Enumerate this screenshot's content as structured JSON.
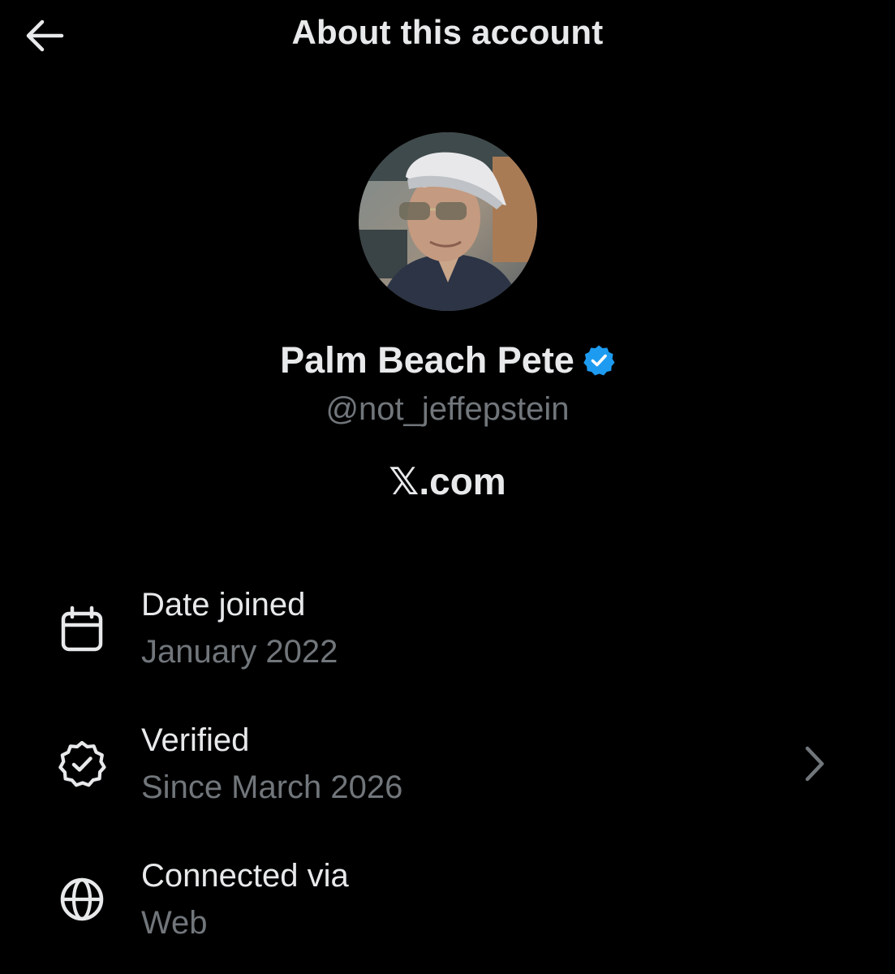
{
  "header": {
    "title": "About this account",
    "back_icon": "arrow-left-icon"
  },
  "profile": {
    "avatar_icon": "profile-photo",
    "display_name": "Palm Beach Pete",
    "verified_badge_icon": "verified-badge-icon",
    "handle": "@not_jeffepstein",
    "site": "𝕏.com"
  },
  "details": [
    {
      "icon": "calendar-icon",
      "label": "Date joined",
      "value": "January 2022"
    },
    {
      "icon": "verified-outline-icon",
      "label": "Verified",
      "value": "Since March 2026",
      "chevron_icon": "chevron-right-icon"
    },
    {
      "icon": "globe-icon",
      "label": "Connected via",
      "value": "Web"
    }
  ],
  "colors": {
    "background": "#000000",
    "primary_text": "#e7e9ea",
    "secondary_text": "#71767b",
    "verified_blue": "#1d9bf0"
  }
}
